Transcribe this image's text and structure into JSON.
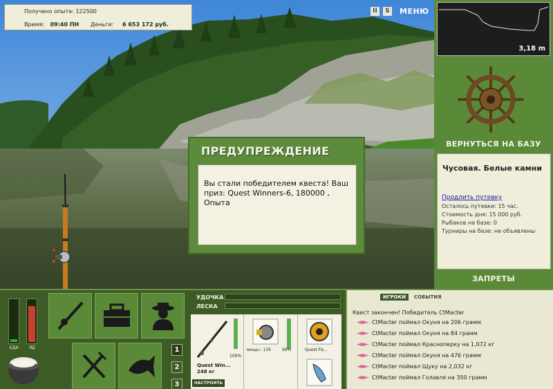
{
  "info": {
    "experience_label": "Получено опыта:",
    "experience_value": "122500",
    "time_label": "Время:",
    "time_value": "09:40 ПН",
    "money_label": "Деньги:",
    "money_value": "6 653 172 руб."
  },
  "top_controls": {
    "pause_glyph": "II",
    "sound_glyph": "S",
    "menu_label": "МЕНЮ"
  },
  "minimap": {
    "depth": "3,18 m"
  },
  "warning": {
    "title": "ПРЕДУПРЕЖДЕНИЕ",
    "text": "Вы стали победителем квеста! Ваш приз: Quest Winners-6, 180000 , Опыта"
  },
  "right_panel": {
    "back_label": "ВЕРНУТЬСЯ НА БАЗУ",
    "location_name": "Чусовая. Белые камни",
    "extend_link": "Продлить путевку",
    "trip_left": "Осталось путевки: 15 час.",
    "day_cost": "Стоимость дня: 15 000 руб.",
    "anglers": "Рыбаков на базе: 0",
    "tournaments": "Турниры на базе: не объявлены",
    "bans_label": "ЗАПРЕТЫ"
  },
  "gauges": {
    "food_label": "ЕДА",
    "poison_label": "ЯД",
    "food_level": 0.12,
    "poison_level": 0.88
  },
  "pages": [
    "1",
    "2",
    "3"
  ],
  "tackle": {
    "rod_label": "УДОЧКА",
    "line_label": "ЛЕСКА",
    "rod_name": "Quest Win...",
    "rod_weight": "248 кг",
    "rod_condition": "100%",
    "reel_label": "мощн.: 135",
    "reel_condition": "99%",
    "line_item": "Quest Fis...",
    "setup_label": "НАСТРОИТЬ"
  },
  "events": {
    "tab_players": "ИГРОКИ",
    "tab_events": "СОБЫТИЯ",
    "message": "Квест закончен! Победитель CtMacter",
    "catches": [
      "CtMacter поймал Окуня на 206 грамм",
      "CtMacter поймал Окуня на 84 грамм",
      "CtMacter поймал Красноперку на 1,072 кг",
      "CtMacter поймал Окуня на 476 грамм",
      "CtMacter поймал Щуку на 2,032 кг",
      "CtMacter поймал Голавля на 350 грамм"
    ]
  },
  "colors": {
    "panel_green": "#5a8a38",
    "dark_green": "#3d5b25",
    "cream": "#efeeda",
    "lure_pink": "#d9679a"
  }
}
